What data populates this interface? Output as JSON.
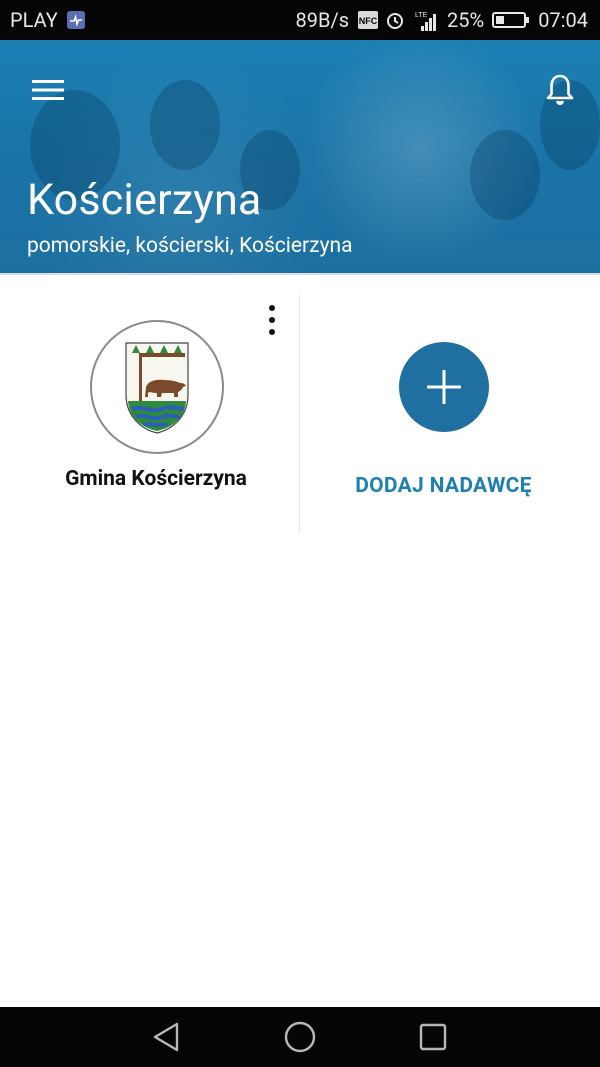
{
  "status_bar": {
    "carrier": "PLAY",
    "network_speed": "89B/s",
    "nfc": "NFC",
    "battery": "25%",
    "time": "07:04",
    "network_type": "LTE"
  },
  "header": {
    "title": "Kościerzyna",
    "subtitle": "pomorskie, kościerski, Kościerzyna",
    "menu_icon": "menu-icon",
    "notification_icon": "bell-icon"
  },
  "cards": [
    {
      "name": "Gmina Kościerzyna",
      "icon": "coat-of-arms-icon",
      "more_icon": "more-vert-icon"
    },
    {
      "label": "DODAJ NADAWCĘ",
      "icon": "plus-icon"
    }
  ],
  "nav_bar": {
    "back_icon": "back-icon",
    "home_icon": "home-icon",
    "recents_icon": "recents-icon"
  },
  "colors": {
    "header": "#1c76a9",
    "accent": "#1f6fa0",
    "link": "#1f7fb3",
    "status_bar": "#050505"
  }
}
